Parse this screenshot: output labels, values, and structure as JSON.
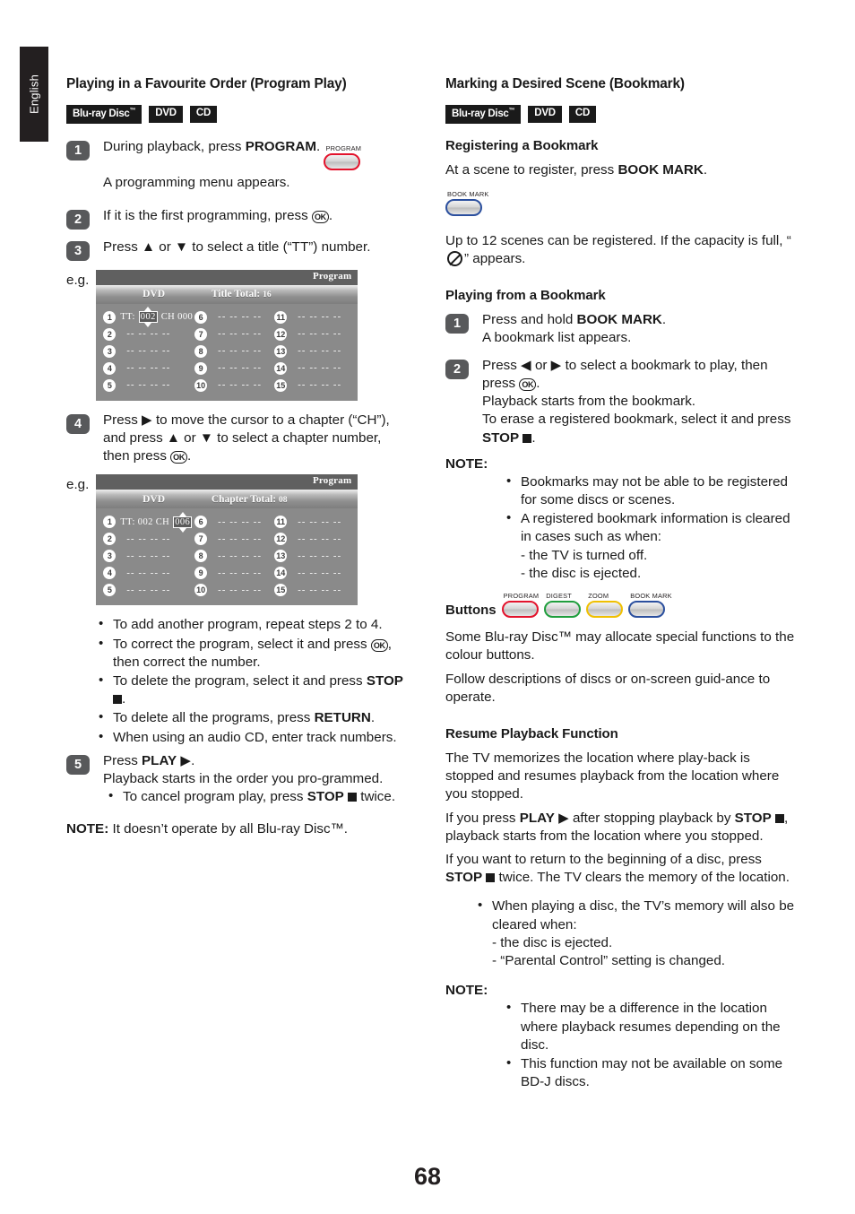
{
  "language_tab": "English",
  "page_number": "68",
  "badges": {
    "bluray": "Blu-ray Disc",
    "tm": "™",
    "dvd": "DVD",
    "cd": "CD"
  },
  "left": {
    "heading": "Playing in a Favourite Order (Program Play)",
    "step1": {
      "num": "1",
      "text_a": "During playback, press ",
      "text_b": "PROGRAM",
      "text_c": ".",
      "button_caption": "PROGRAM",
      "after": "A programming menu appears."
    },
    "step2": {
      "num": "2",
      "text_a": "If it is the first programming, press ",
      "ok": "OK",
      "text_c": "."
    },
    "step3": {
      "num": "3",
      "text": "Press ▲ or ▼ to select a title (“TT”) number."
    },
    "eg1_label": "e.g.",
    "eg1": {
      "title": "Program",
      "disc": "DVD",
      "total_label": "Title Total:",
      "total_value": "16",
      "row1_tt_label": "TT:",
      "row1_tt_value": "002",
      "row1_ch_label": "CH",
      "row1_ch_value": "000",
      "selected": "tt",
      "dashes": "-- -- -- --",
      "numbers": [
        "1",
        "2",
        "3",
        "4",
        "5",
        "6",
        "7",
        "8",
        "9",
        "10",
        "11",
        "12",
        "13",
        "14",
        "15"
      ]
    },
    "step4": {
      "num": "4",
      "text_a": "Press ▶ to move the cursor to a chapter (“CH”), and press ▲ or ▼ to select a chapter number, then press ",
      "ok": "OK",
      "text_c": "."
    },
    "eg2_label": "e.g.",
    "eg2": {
      "title": "Program",
      "disc": "DVD",
      "total_label": "Chapter Total:",
      "total_value": "08",
      "row1_tt_label": "TT:",
      "row1_tt_value": "002",
      "row1_ch_label": "CH",
      "row1_ch_value": "006",
      "selected": "ch",
      "dashes": "-- -- -- --",
      "numbers": [
        "1",
        "2",
        "3",
        "4",
        "5",
        "6",
        "7",
        "8",
        "9",
        "10",
        "11",
        "12",
        "13",
        "14",
        "15"
      ]
    },
    "bullets": [
      {
        "parts": [
          {
            "t": "To add another program, repeat steps 2 to 4."
          }
        ]
      },
      {
        "parts": [
          {
            "t": "To correct the program, select it and press "
          },
          {
            "ok": "OK"
          },
          {
            "t": ", then correct the number."
          }
        ]
      },
      {
        "parts": [
          {
            "t": "To delete the program, select it and press "
          },
          {
            "b": "STOP"
          },
          {
            "t": " "
          },
          {
            "sq": true
          },
          {
            "t": "."
          }
        ]
      },
      {
        "parts": [
          {
            "t": "To delete all the programs, press "
          },
          {
            "b": "RETURN"
          },
          {
            "t": "."
          }
        ]
      },
      {
        "parts": [
          {
            "t": "When using an audio CD, enter track numbers."
          }
        ]
      }
    ],
    "step5": {
      "num": "5",
      "text_a": "Press ",
      "play": "PLAY",
      "text_b": " ▶.",
      "line2": "Playback starts in the order you pro-grammed.",
      "bullet_a": "To cancel program play, press ",
      "bullet_b": "STOP",
      "bullet_c": " twice."
    },
    "note": {
      "label": "NOTE:",
      "text": " It doesn’t operate by all Blu-ray Disc™."
    }
  },
  "right": {
    "heading": "Marking a Desired Scene (Bookmark)",
    "sub_register": "Registering a Bookmark",
    "register": {
      "text_a": "At a scene to register, press ",
      "text_b": "BOOK MARK",
      "text_c": ".",
      "button_caption": "BOOK MARK",
      "capacity_a": "Up to 12 scenes can be registered. If the capacity is full, “",
      "capacity_b": "” appears."
    },
    "sub_playing": "Playing from a Bookmark",
    "step1": {
      "num": "1",
      "text_a": "Press and hold ",
      "text_b": "BOOK MARK",
      "text_c": ".",
      "line2": "A bookmark list appears."
    },
    "step2": {
      "num": "2",
      "text_a": "Press ◀ or ▶ to select a bookmark to play, then press ",
      "ok": "OK",
      "text_c": ".",
      "line2": "Playback starts from the bookmark.",
      "line3_a": "To erase a registered bookmark, select it and press ",
      "line3_b": "STOP",
      "line3_c": "."
    },
    "note1": {
      "label": "NOTE:",
      "items": [
        "Bookmarks may not be able to be registered for some discs or scenes.",
        "A registered bookmark information is cleared in cases such as when:\n- the TV is turned off.\n- the disc is ejected."
      ]
    },
    "buttons_section": {
      "label": "Buttons",
      "keys": [
        {
          "caption": "PROGRAM",
          "colour": "#e3132c",
          "colour_name": "red"
        },
        {
          "caption": "DIGEST",
          "colour": "#1f9e3d",
          "colour_name": "green"
        },
        {
          "caption": "ZOOM",
          "colour": "#f0c000",
          "colour_name": "yellow"
        },
        {
          "caption": "BOOK MARK",
          "colour": "#2b4f9e",
          "colour_name": "blue"
        }
      ],
      "text1": "Some Blu-ray Disc™ may allocate special functions to the colour buttons.",
      "text2": "Follow descriptions of discs or on-screen guid-ance to operate."
    },
    "resume": {
      "heading": "Resume Playback Function",
      "p1": "The TV memorizes the location where play-back is stopped and resumes playback from the location where you stopped.",
      "p2_a": "If you press ",
      "p2_play": "PLAY",
      "p2_b": " ▶ after stopping playback by ",
      "p2_stop": "STOP",
      "p2_c": ", playback starts from the location where you stopped.",
      "p3_a": "If you want to return to the beginning of a disc, press ",
      "p3_stop": "STOP",
      "p3_b": " twice. The TV clears the memory of the location.",
      "bullet": "When playing a disc, the TV’s memory will also be cleared when:\n- the disc is ejected.\n- “Parental Control” setting is changed."
    },
    "note2": {
      "label": "NOTE:",
      "items": [
        "There may be a difference in the location where playback resumes depending on the disc.",
        "This function may not be available on some BD-J discs."
      ]
    }
  }
}
